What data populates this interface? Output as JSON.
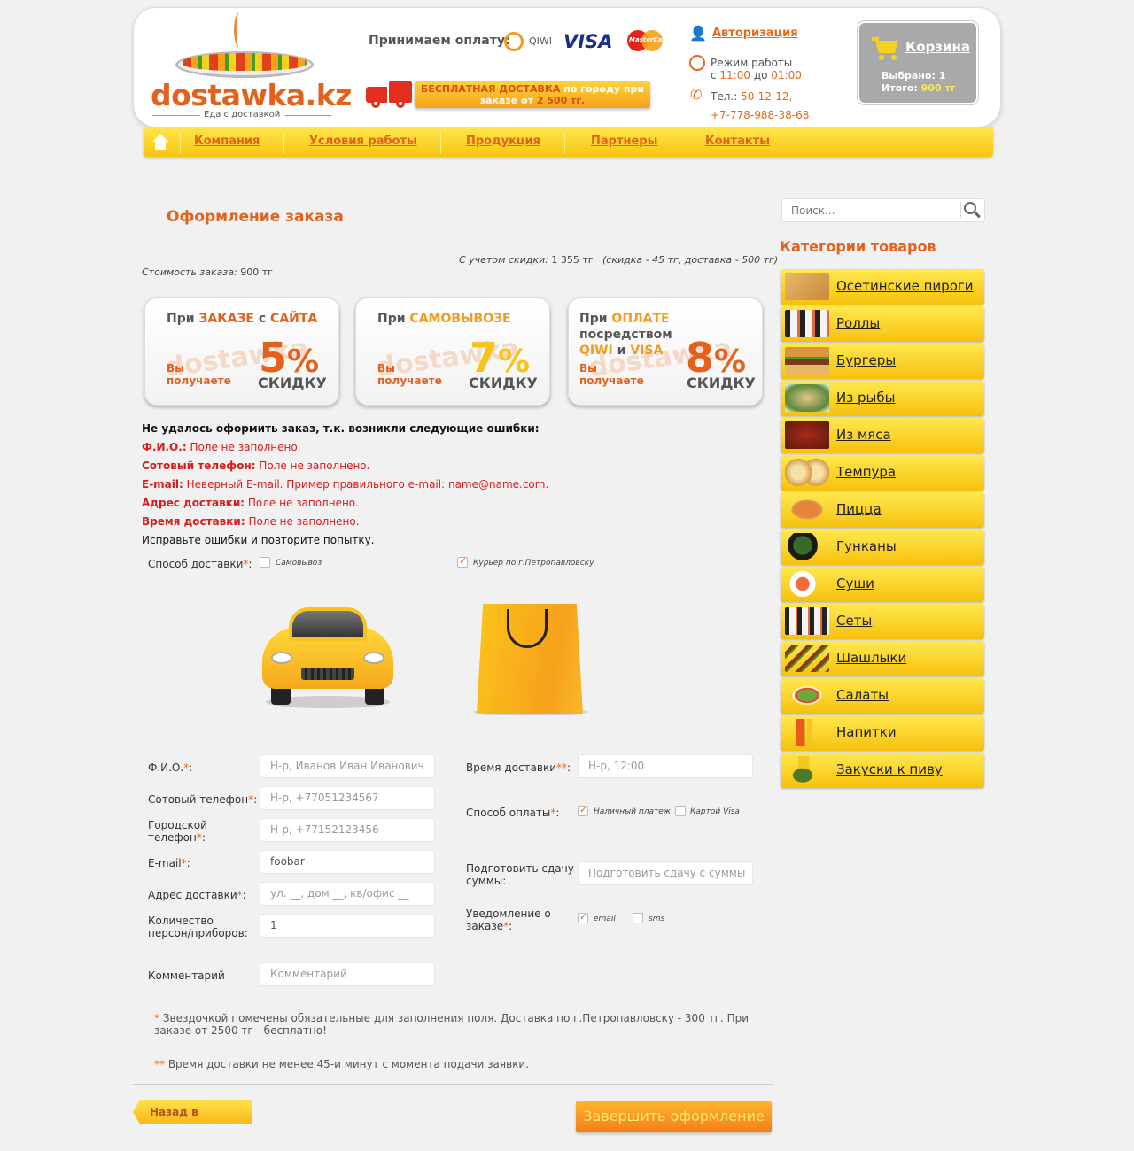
{
  "header": {
    "logo_text": "dostawka.kz",
    "logo_sub": "Еда с доставкой",
    "pay_label": "Принимаем оплату:",
    "qiwi": "QIWI",
    "visa": "VISA",
    "mastercard": "MasterCard",
    "free_delivery_1": "БЕСПЛАТНАЯ ДОСТАВКА",
    "free_delivery_2": " по городу при",
    "free_delivery_3": "заказе от ",
    "free_delivery_4": "2 500 тг.",
    "auth_link": "Авторизация",
    "hours_label": "Режим работы",
    "hours_from": "с ",
    "hours_start": "11:00",
    "hours_to": " до ",
    "hours_end": "01:00",
    "tel_label": "Тел.: ",
    "tel_1": "50-12-12,",
    "tel_2": "+7-778-988-38-68",
    "cart_title": "Корзина",
    "cart_selected": "Выбрано: 1",
    "cart_total_label": "Итого: ",
    "cart_total_value": "900 тг"
  },
  "nav": [
    "Компания",
    "Условия работы",
    "Продукция",
    "Партнеры",
    "Контакты"
  ],
  "page": {
    "title": "Оформление заказа",
    "discount_label": "С учетом скидки:",
    "discount_value": " 1 355 тг",
    "discount_detail": "(скидка - 45 тг, доставка - 500 тг)",
    "cost_label": "Стоимость заказа:",
    "cost_value": " 900 тг"
  },
  "promos": [
    {
      "pre": "При ",
      "h1": "ЗАКАЗЕ",
      "mid": " с ",
      "h2": "САЙТА",
      "line2": "",
      "you1": "Вы",
      "you2": "получаете",
      "pct": "5",
      "skidka": "СКИДКУ",
      "wm": "dostawka"
    },
    {
      "pre": "При ",
      "h1": "САМОВЫВОЗЕ",
      "mid": "",
      "h2": "",
      "line2": "",
      "you1": "Вы",
      "you2": "получаете",
      "pct": "7",
      "skidka": "СКИДКУ",
      "wm": "dostawka"
    },
    {
      "pre": "При ",
      "h1": "ОПЛАТЕ",
      "mid": " посредством",
      "h2": "",
      "line2a": "QIWI",
      "line2b": " и ",
      "line2c": "VISA",
      "you1": "Вы",
      "you2": "получаете",
      "pct": "8",
      "skidka": "СКИДКУ",
      "wm": "dostawka"
    }
  ],
  "errors": {
    "title": "Не удалось оформить заказ, т.к. возникли следующие ошибки:",
    "items": [
      {
        "field": "Ф.И.О.:",
        "msg": " Поле не заполнено."
      },
      {
        "field": "Сотовый телефон:",
        "msg": " Поле не заполнено."
      },
      {
        "field": "E-mail:",
        "msg": " Неверный E-mail. Пример правильного e-mail: name@name.com."
      },
      {
        "field": "Адрес доставки:",
        "msg": " Поле не заполнено."
      },
      {
        "field": "Время доставки:",
        "msg": " Поле не заполнено."
      }
    ],
    "fix": "Исправьте ошибки и повторите попытку."
  },
  "delivery": {
    "label": "Способ доставки",
    "option_pickup": "Самовывоз",
    "option_courier": "Курьер по г.Петропавловску"
  },
  "form": {
    "fio_label": "Ф.И.О.",
    "fio_ph": "Н-р, Иванов Иван Иванович",
    "mobile_label": "Сотовый телефон",
    "mobile_ph": "Н-р, +77051234567",
    "city_label_1": "Городской",
    "city_label_2": "телефон",
    "city_ph": "Н-р, +77152123456",
    "email_label": "E-mail",
    "email_value": "foobar",
    "address_label": "Адрес доставки",
    "address_ph": "ул. __, дом __, кв/офис __",
    "persons_label_1": "Количество",
    "persons_label_2": "персон/приборов:",
    "persons_value": "1",
    "comment_label": "Комментарий",
    "comment_ph": "Комментарий",
    "time_label": "Время доставки",
    "time_ph": "Н-р, 12:00",
    "payment_label": "Способ оплаты",
    "payment_cash": "Наличный платеж",
    "payment_visa": "Картой Visa",
    "change_label_1": "Подготовить сдачу с",
    "change_label_2": "суммы:",
    "change_ph": "Подготовить сдачу с суммы",
    "notify_label_1": "Уведомление о",
    "notify_label_2": "заказе",
    "notify_email": "email",
    "notify_sms": "sms",
    "star": "*",
    "dstar": "**"
  },
  "notes": {
    "note1": " Звездочкой помечены обязательные для заполнения поля. Доставка по г.Петропавловску - 300 тг. При заказе от 2500 тг - бесплатно!",
    "note2": " Время доставки не менее 45-и минут с момента подачи заявки."
  },
  "buttons": {
    "back": "Назад в корзину",
    "finish": "Завершить оформление"
  },
  "sidebar": {
    "search_ph": "Поиск...",
    "cat_title": "Категории товаров",
    "categories": [
      "Осетинские пироги",
      "Роллы",
      "Бургеры",
      "Из рыбы",
      "Из мяса",
      "Темпура",
      "Пицца",
      "Гунканы",
      "Суши",
      "Сеты",
      "Шашлыки",
      "Салаты",
      "Напитки",
      "Закуски к пиву"
    ]
  },
  "colors": {
    "accent": "#e2621d",
    "yellow": "#f6c10d",
    "error": "#d91b1b"
  }
}
